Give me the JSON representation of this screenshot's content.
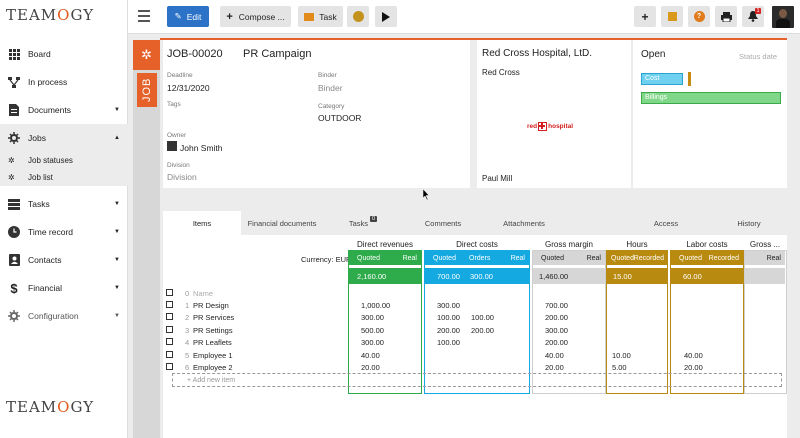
{
  "app": {
    "logo_text": "TEAMOGY"
  },
  "topbar": {
    "edit_label": "Edit",
    "compose_label": "Compose ...",
    "task_label": "Task",
    "notification_count": "1"
  },
  "sidebar": {
    "items": [
      {
        "label": "Board",
        "icon": "grid-icon"
      },
      {
        "label": "In process",
        "icon": "process-icon"
      },
      {
        "label": "Documents",
        "icon": "document-icon",
        "arrow": "▼"
      },
      {
        "label": "Jobs",
        "icon": "jobs-icon",
        "arrow": "▲"
      },
      {
        "label": "Tasks",
        "icon": "tasks-icon",
        "arrow": "▼"
      },
      {
        "label": "Time record",
        "icon": "clock-icon",
        "arrow": "▼"
      },
      {
        "label": "Contacts",
        "icon": "contacts-icon",
        "arrow": "▼"
      },
      {
        "label": "Financial",
        "icon": "dollar-icon",
        "arrow": "▼"
      },
      {
        "label": "Configuration",
        "icon": "gear-icon",
        "arrow": "▼"
      }
    ],
    "sub_items": [
      {
        "label": "Job statuses"
      },
      {
        "label": "Job list"
      }
    ]
  },
  "job": {
    "strip_label": "JOB",
    "number": "JOB-00020",
    "name": "PR Campaign",
    "deadline_label": "Deadline",
    "deadline": "12/31/2020",
    "binder_label": "Binder",
    "binder": "Binder",
    "tags_label": "Tags",
    "category_label": "Category",
    "category": "OUTDOOR",
    "owner_label": "Owner",
    "owner": "John Smith",
    "division_label": "Division",
    "division": "Division"
  },
  "client": {
    "name": "Red Cross Hospital, LtD.",
    "company": "Red Cross",
    "logo_text_left": "red",
    "logo_text_right": "hospital",
    "contact": "Paul Mill"
  },
  "status": {
    "value": "Open",
    "date_placeholder": "Status date",
    "cost_label": "Cost",
    "billings_label": "Billings"
  },
  "tabs": [
    "Items",
    "Financial documents",
    "Tasks",
    "Comments",
    "Attachments",
    "Access",
    "History"
  ],
  "tasks_badge": "0",
  "grid": {
    "currency_label": "Currency: EUR",
    "headers": {
      "direct_revenues": "Direct revenues",
      "direct_costs": "Direct costs",
      "gross_margin": "Gross margin",
      "hours": "Hours",
      "labor_costs": "Labor costs",
      "gross2": "Gross ..."
    },
    "subheaders": {
      "quoted": "Quoted",
      "real": "Real",
      "orders": "Orders",
      "recorded": "Recorded"
    },
    "totals": {
      "dr_quoted": "2,160.00",
      "dc_quoted": "700.00",
      "dc_orders": "300.00",
      "gm_quoted": "1,460.00",
      "hours_quoted": "15.00",
      "lc_quoted": "60.00"
    },
    "name_placeholder": "Name",
    "add_new_item": "+ Add new item",
    "rows": [
      {
        "n": "1",
        "name": "PR Design",
        "dr": "1,000.00",
        "dcq": "300.00",
        "dco": "",
        "gm": "700.00",
        "hq": "",
        "lcq": ""
      },
      {
        "n": "2",
        "name": "PR Services",
        "dr": "300.00",
        "dcq": "100.00",
        "dco": "100.00",
        "gm": "200.00",
        "hq": "",
        "lcq": ""
      },
      {
        "n": "3",
        "name": "PR Settings",
        "dr": "500.00",
        "dcq": "200.00",
        "dco": "200.00",
        "gm": "300.00",
        "hq": "",
        "lcq": ""
      },
      {
        "n": "4",
        "name": "PR Leaflets",
        "dr": "300.00",
        "dcq": "100.00",
        "dco": "",
        "gm": "200.00",
        "hq": "",
        "lcq": ""
      },
      {
        "n": "5",
        "name": "Employee 1",
        "dr": "40.00",
        "dcq": "",
        "dco": "",
        "gm": "40.00",
        "hq": "10.00",
        "lcq": "40.00"
      },
      {
        "n": "6",
        "name": "Employee 2",
        "dr": "20.00",
        "dcq": "",
        "dco": "",
        "gm": "20.00",
        "hq": "5.00",
        "lcq": "20.00"
      }
    ],
    "row0_n": "0"
  },
  "colors": {
    "green": "#2eab4b",
    "blue": "#14a9e0",
    "gold": "#b88a10",
    "gray": "#d6d6d6",
    "orange": "#e6602a"
  }
}
